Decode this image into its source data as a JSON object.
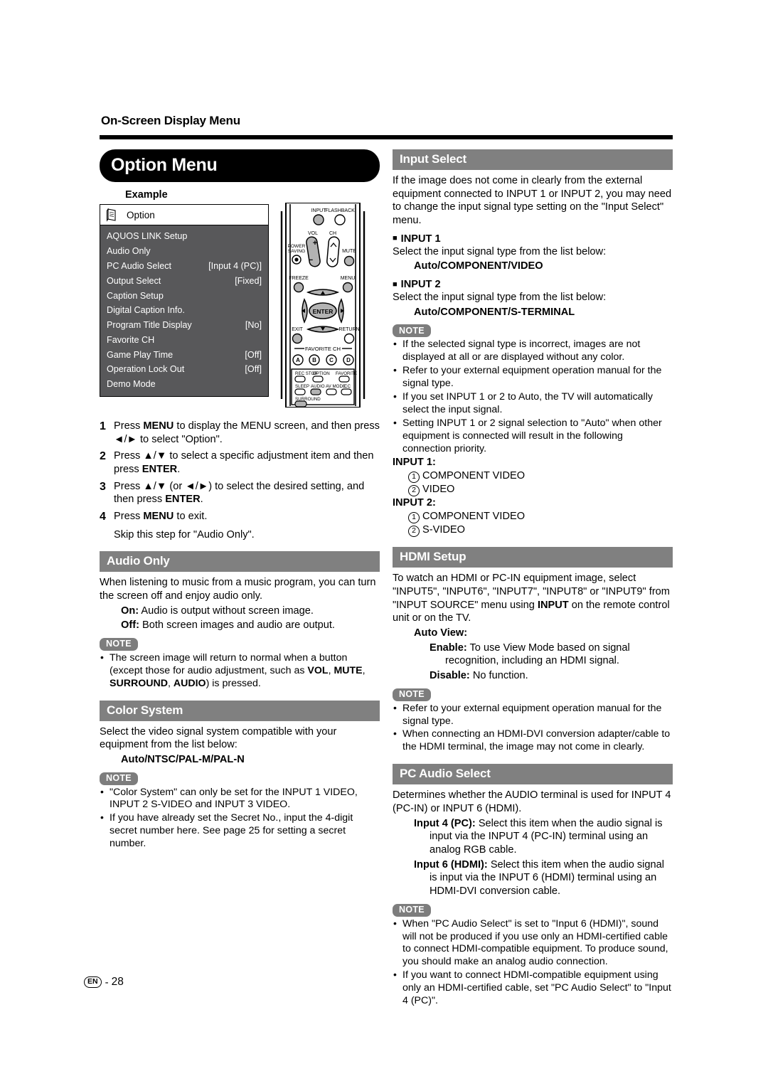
{
  "running_head": "On-Screen Display Menu",
  "page_title": "Option Menu",
  "footer": {
    "locale_badge": "EN",
    "dash": "-",
    "page_number": "28"
  },
  "example": {
    "label": "Example",
    "osd_title": "Option",
    "rows": [
      {
        "label": "AQUOS LINK Setup",
        "value": ""
      },
      {
        "label": "Audio Only",
        "value": ""
      },
      {
        "label": "PC Audio Select",
        "value": "[Input 4 (PC)]"
      },
      {
        "label": "Output Select",
        "value": "[Fixed]"
      },
      {
        "label": "Caption Setup",
        "value": ""
      },
      {
        "label": "Digital Caption Info.",
        "value": ""
      },
      {
        "label": "Program Title Display",
        "value": "[No]"
      },
      {
        "label": "Favorite CH",
        "value": ""
      },
      {
        "label": "Game Play Time",
        "value": "[Off]"
      },
      {
        "label": "Operation Lock Out",
        "value": "[Off]"
      },
      {
        "label": "Demo Mode",
        "value": ""
      }
    ]
  },
  "remote": {
    "labels": {
      "input": "INPUT",
      "flashback": "FLASHBACK",
      "vol": "VOL",
      "ch": "CH",
      "power_saving_1": "POWER",
      "power_saving_2": "SAVING",
      "mute": "MUTE",
      "freeze": "FREEZE",
      "menu": "MENU",
      "enter": "ENTER",
      "exit": "EXIT",
      "return": "RETURN",
      "favorite_ch": "FAVORITE CH",
      "a": "A",
      "b": "B",
      "c": "C",
      "d": "D",
      "rec_stop": "REC STOP",
      "option": "OPTION",
      "favorite": "FAVORITE",
      "sleep": "SLEEP",
      "audio": "AUDIO",
      "av_mode": "AV MODE",
      "cc": "CC",
      "surround": "SURROUND"
    }
  },
  "steps": [
    {
      "n": "1",
      "text_html": "Press <b>MENU</b> to display the MENU screen, and then press ◄/► to select \"Option\"."
    },
    {
      "n": "2",
      "text_html": "Press ▲/▼ to select a specific adjustment item and then press <b>ENTER</b>."
    },
    {
      "n": "3",
      "text_html": "Press ▲/▼ (or ◄/►) to select the desired setting, and then press <b>ENTER</b>."
    },
    {
      "n": "4",
      "text_html": "Press <b>MENU</b> to exit."
    }
  ],
  "step4_sub": "Skip this step for \"Audio Only\".",
  "audio_only": {
    "heading": "Audio Only",
    "body": "When listening to music from a music program, you can turn the screen off and enjoy audio only.",
    "options": [
      {
        "term": "On:",
        "desc": "Audio is output without screen image."
      },
      {
        "term": "Off:",
        "desc": "Both screen images and audio are output."
      }
    ],
    "note_badge": "NOTE",
    "notes_html": [
      "The screen image will return to normal when a button (except those for audio adjustment, such as <b>VOL</b>, <b>MUTE</b>, <b>SURROUND</b>, <b>AUDIO</b>) is pressed."
    ]
  },
  "color_system": {
    "heading": "Color System",
    "body": "Select the video signal system compatible with your equipment from the list below:",
    "list": "Auto/NTSC/PAL-M/PAL-N",
    "note_badge": "NOTE",
    "notes_html": [
      "\"Color System\" can only be set for the INPUT 1 VIDEO, INPUT 2 S-VIDEO and INPUT 3 VIDEO.",
      "If you have already set the Secret No., input the 4-digit secret number here. See page 25 for setting a secret number."
    ]
  },
  "input_select": {
    "heading": "Input Select",
    "body": "If the image does not come in clearly from the external equipment connected to INPUT 1 or INPUT 2, you may need to change the input signal type setting on the \"Input Select\" menu.",
    "blocks": [
      {
        "title": "INPUT 1",
        "line": "Select the input signal type from the list below:",
        "list": "Auto/COMPONENT/VIDEO"
      },
      {
        "title": "INPUT 2",
        "line": "Select the input signal type from the list below:",
        "list": "Auto/COMPONENT/S-TERMINAL"
      }
    ],
    "note_badge": "NOTE",
    "notes_html": [
      "If the selected signal type is incorrect, images are not displayed at all or are displayed without any color.",
      "Refer to your external equipment operation manual for the signal type.",
      "If you set INPUT 1 or 2 to Auto, the TV will automatically select the input signal.",
      "Setting INPUT 1 or 2 signal selection to \"Auto\" when other equipment is connected will result in the following connection priority."
    ],
    "priority": [
      {
        "head": "INPUT 1:",
        "items": [
          {
            "n": "1",
            "text": "COMPONENT VIDEO"
          },
          {
            "n": "2",
            "text": "VIDEO"
          }
        ]
      },
      {
        "head": "INPUT 2:",
        "items": [
          {
            "n": "1",
            "text": "COMPONENT VIDEO"
          },
          {
            "n": "2",
            "text": "S-VIDEO"
          }
        ]
      }
    ]
  },
  "hdmi_setup": {
    "heading": "HDMI Setup",
    "body_html": "To watch an HDMI or PC-IN equipment image, select \"INPUT5\", \"INPUT6\", \"INPUT7\", \"INPUT8\" or \"INPUT9\" from \"INPUT SOURCE\" menu using <b>INPUT</b> on the remote control unit or on the TV.",
    "auto_view_label": "Auto View:",
    "options": [
      {
        "term": "Enable:",
        "desc": "To use View Mode based on signal recognition, including an HDMI signal."
      },
      {
        "term": "Disable:",
        "desc": "No function."
      }
    ],
    "note_badge": "NOTE",
    "notes_html": [
      "Refer to your external equipment operation manual for the signal type.",
      "When connecting an HDMI-DVI conversion adapter/cable to the HDMI terminal, the image may not come in clearly."
    ]
  },
  "pc_audio_select": {
    "heading": "PC Audio Select",
    "body": "Determines whether the AUDIO terminal is used for INPUT 4 (PC-IN) or INPUT 6 (HDMI).",
    "options": [
      {
        "term": "Input 4 (PC):",
        "desc": "Select this item when the audio signal is input via the INPUT 4 (PC-IN) terminal using an analog RGB cable."
      },
      {
        "term": "Input 6 (HDMI):",
        "desc": "Select this item when the audio signal is input via the INPUT 6 (HDMI) terminal using an HDMI-DVI conversion cable."
      }
    ],
    "note_badge": "NOTE",
    "notes_html": [
      "When \"PC Audio Select\" is set to \"Input 6 (HDMI)\", sound will not be produced if you use only an HDMI-certified cable to connect HDMI-compatible equipment. To produce sound, you should make an analog audio connection.",
      "If you want to connect HDMI-compatible equipment using only an HDMI-certified cable, set \"PC Audio Select\" to \"Input 4 (PC)\"."
    ]
  },
  "colors": {
    "section_header_bg": "#808080",
    "pill_bg": "#000000",
    "osd_list_bg": "#58585a",
    "note_badge_bg": "#7d7d7d"
  }
}
